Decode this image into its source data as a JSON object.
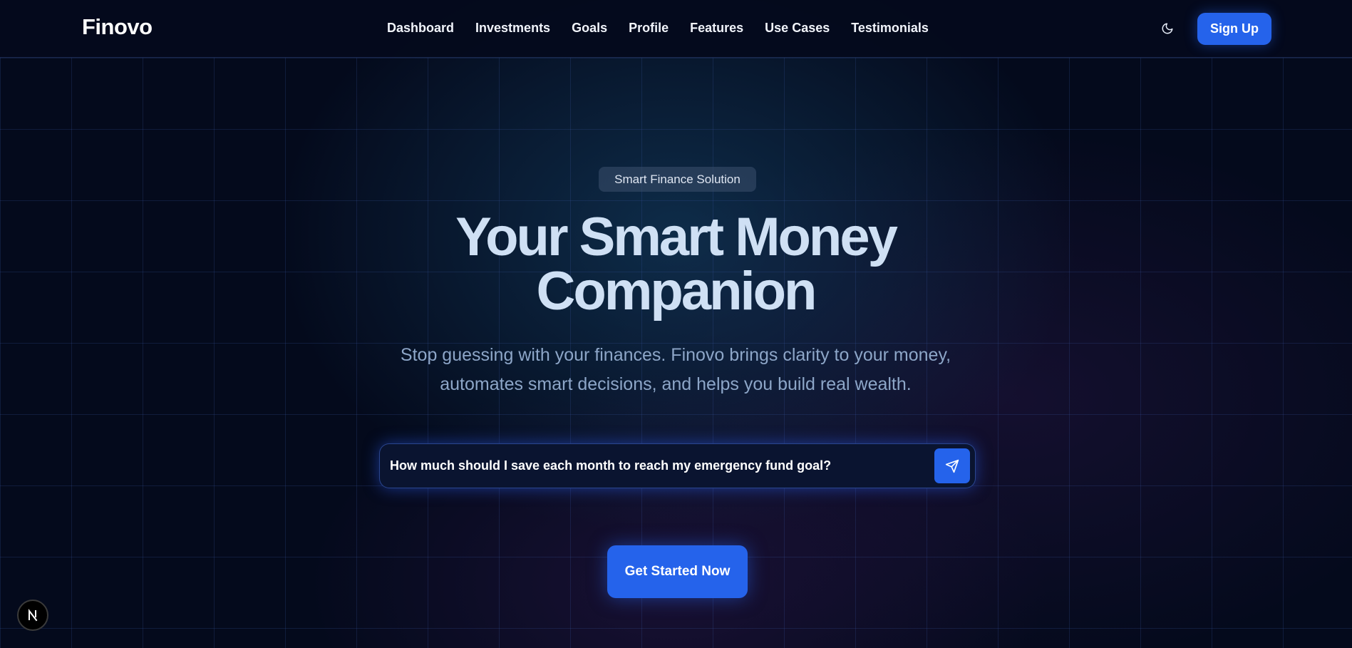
{
  "brand": {
    "name": "Finovo",
    "accent_color": "#2563eb",
    "background_color": "#040a1c"
  },
  "nav": {
    "links": [
      "Dashboard",
      "Investments",
      "Goals",
      "Profile",
      "Features",
      "Use Cases",
      "Testimonials"
    ],
    "theme_toggle_icon": "moon-icon",
    "signup_label": "Sign Up"
  },
  "hero": {
    "badge": "Smart Finance Solution",
    "title_line1": "Your Smart Money",
    "title_line2": "Companion",
    "subtitle_line1": "Stop guessing with your finances. Finovo brings clarity to your money,",
    "subtitle_line2": "automates smart decisions, and helps you build real wealth."
  },
  "ask": {
    "value": "How much should I save each month to reach my emergency fund goal?",
    "send_icon": "send-icon"
  },
  "cta": {
    "label": "Get Started Now"
  },
  "dev_badge": {
    "letter": "N"
  }
}
